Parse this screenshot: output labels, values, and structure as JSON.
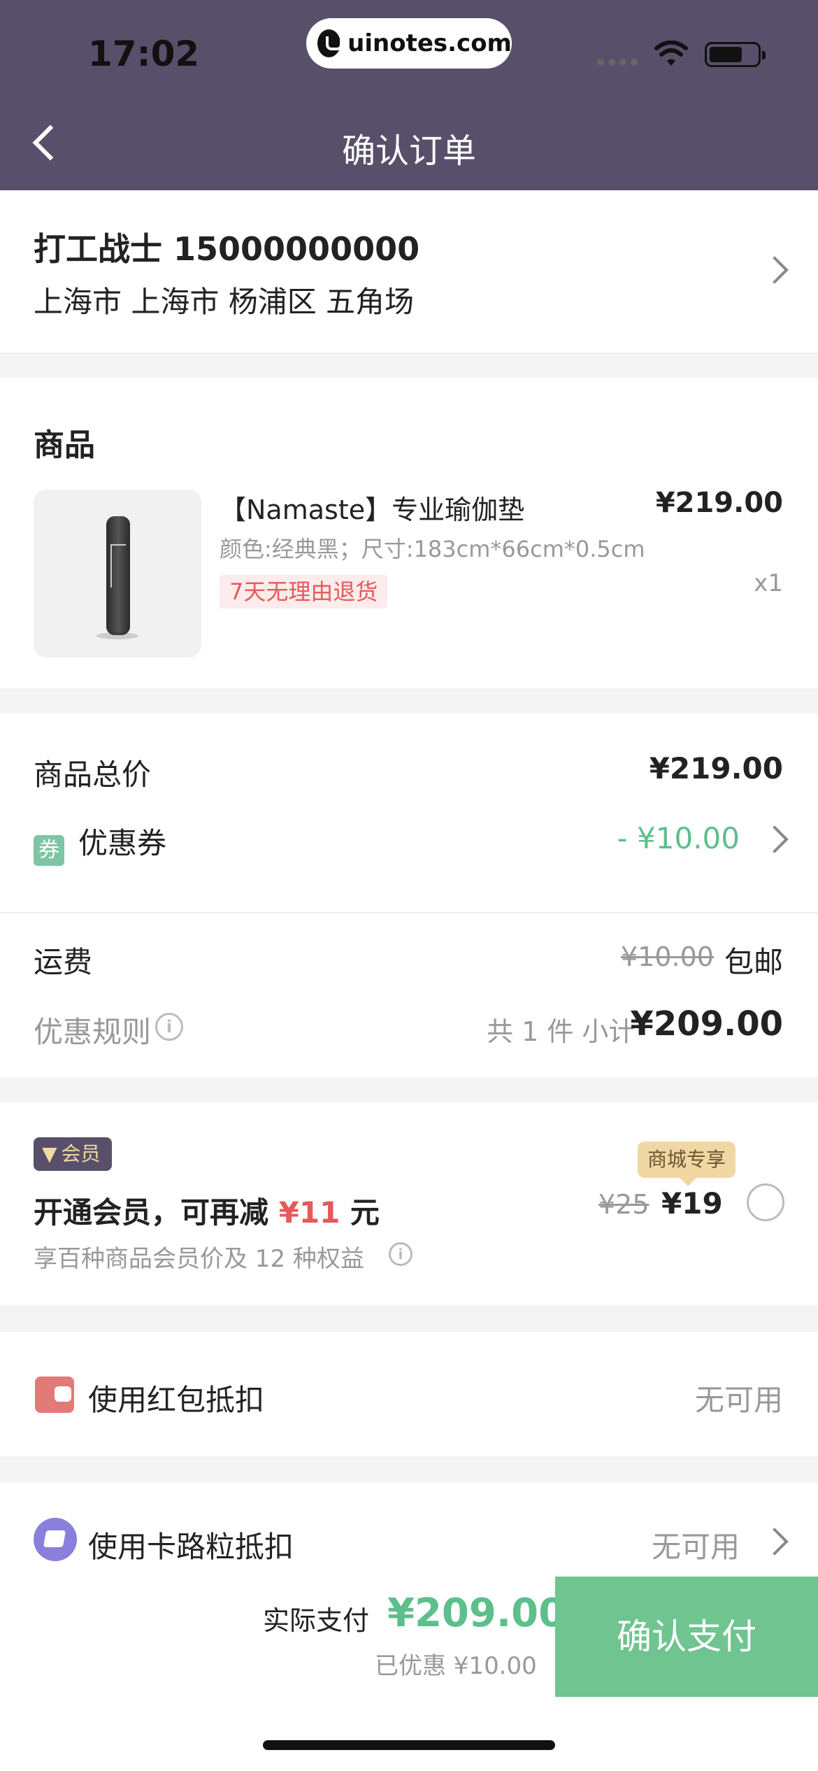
{
  "status": {
    "time": "17:02",
    "watermark": "uinotes.com"
  },
  "nav": {
    "title": "确认订单"
  },
  "address": {
    "name": "打工战士  15000000000",
    "detail": "上海市 上海市 杨浦区 五角场"
  },
  "product_section": {
    "title": "商品",
    "item": {
      "name": "【Namaste】专业瑜伽垫",
      "spec": "颜色:经典黑；尺寸:183cm*66cm*0.5cm",
      "tag": "7天无理由退货",
      "price": "¥219.00",
      "qty": "x1"
    }
  },
  "summary": {
    "total_label": "商品总价",
    "total_value": "¥219.00",
    "coupon_icon": "券",
    "coupon_label": "优惠券",
    "coupon_value": "- ¥10.00",
    "coupon_color": "#5cbf8c"
  },
  "shipping": {
    "label": "运费",
    "old_fee": "¥10.00",
    "fee": "包邮",
    "rule_label": "优惠规则",
    "count_text": "共 1 件 小计",
    "subtotal": "¥209.00"
  },
  "vip": {
    "badge": "会员",
    "title_pre": "开通会员，可再减 ",
    "title_amount": "¥11",
    "title_post": " 元",
    "sub": "享百种商品会员价及 12 种权益",
    "mall_tag": "商城专享",
    "old_price": "¥25",
    "new_price": "¥19"
  },
  "redpack": {
    "label": "使用红包抵扣",
    "value": "无可用"
  },
  "kaluli": {
    "label": "使用卡路粒抵扣",
    "value": "无可用"
  },
  "bottom": {
    "pay_label": "实际支付",
    "pay_amount": "¥209.00",
    "discount": "已优惠 ¥10.00",
    "confirm": "确认支付",
    "accent": "#6fc48f"
  }
}
